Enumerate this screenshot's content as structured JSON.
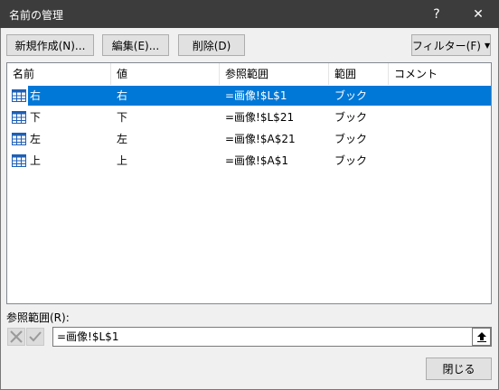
{
  "window": {
    "title": "名前の管理",
    "help_label": "?",
    "close_label": "✕"
  },
  "toolbar": {
    "new_label": "新規作成(N)...",
    "edit_label": "編集(E)...",
    "delete_label": "削除(D)",
    "filter_label": "フィルター(F)",
    "filter_arrow": "▼"
  },
  "columns": [
    "名前",
    "値",
    "参照範囲",
    "範囲",
    "コメント"
  ],
  "rows": [
    {
      "name": "右",
      "value": "右",
      "refers_to": "=画像!$L$1",
      "scope": "ブック",
      "comment": "",
      "selected": true
    },
    {
      "name": "下",
      "value": "下",
      "refers_to": "=画像!$L$21",
      "scope": "ブック",
      "comment": "",
      "selected": false
    },
    {
      "name": "左",
      "value": "左",
      "refers_to": "=画像!$A$21",
      "scope": "ブック",
      "comment": "",
      "selected": false
    },
    {
      "name": "上",
      "value": "上",
      "refers_to": "=画像!$A$1",
      "scope": "ブック",
      "comment": "",
      "selected": false
    }
  ],
  "reference": {
    "label": "参照範囲(R):",
    "value": "=画像!$L$1"
  },
  "footer": {
    "close_label": "閉じる"
  },
  "colors": {
    "selection": "#0078d7",
    "titlebar": "#3c3c3c",
    "table_icon": "#1e5fb4"
  }
}
